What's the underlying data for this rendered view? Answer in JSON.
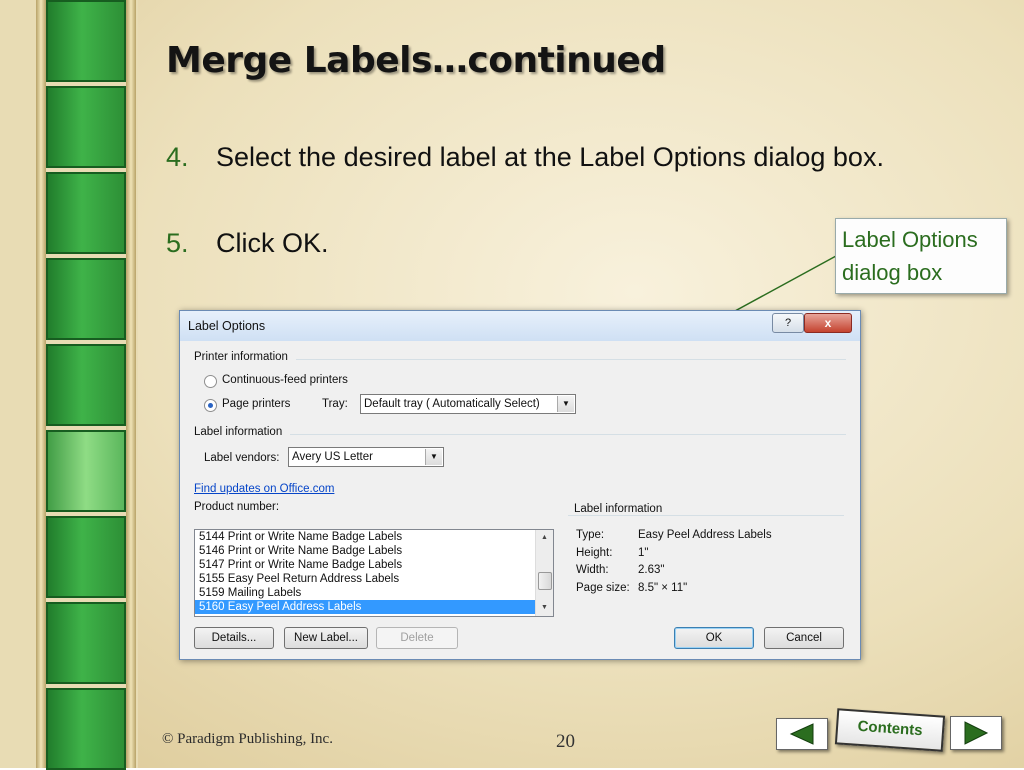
{
  "slide": {
    "title": "Merge Labels…continued",
    "steps": [
      {
        "num": "4.",
        "text": "Select the desired label at the Label Options dialog box."
      },
      {
        "num": "5.",
        "text": "Click OK."
      }
    ],
    "callout": {
      "line1": "Label Options",
      "line2": "dialog box"
    },
    "footer": "© Paradigm Publishing, Inc.",
    "page_number": "20",
    "nav": {
      "back_icon": "triangle-left-icon",
      "contents_label": "Contents",
      "forward_icon": "triangle-right-icon"
    }
  },
  "dialog": {
    "title": "Label Options",
    "help_label": "?",
    "close_label": "x",
    "printer_info_heading": "Printer information",
    "continuous_feed_label": "Continuous-feed printers",
    "page_printers_label": "Page printers",
    "tray_label": "Tray:",
    "tray_value": "Default tray ( Automatically Select)",
    "label_info_heading": "Label information",
    "label_vendors_label": "Label vendors:",
    "label_vendors_value": "Avery US Letter",
    "find_updates_link": "Find updates on Office.com",
    "product_number_label": "Product number:",
    "products": [
      "5144 Print or Write Name Badge Labels",
      "5146 Print or Write Name Badge Labels",
      "5147 Print or Write Name Badge Labels",
      "5155 Easy Peel Return Address Labels",
      "5159 Mailing Labels",
      "5160 Easy Peel Address Labels"
    ],
    "selected_product_index": 5,
    "info_panel": {
      "heading": "Label information",
      "type_label": "Type:",
      "type_value": "Easy Peel Address Labels",
      "height_label": "Height:",
      "height_value": "1\"",
      "width_label": "Width:",
      "width_value": "2.63\"",
      "page_size_label": "Page size:",
      "page_size_value": "8.5\" × 11\""
    },
    "buttons": {
      "details": "Details...",
      "new_label": "New Label...",
      "delete": "Delete",
      "ok": "OK",
      "cancel": "Cancel"
    }
  }
}
